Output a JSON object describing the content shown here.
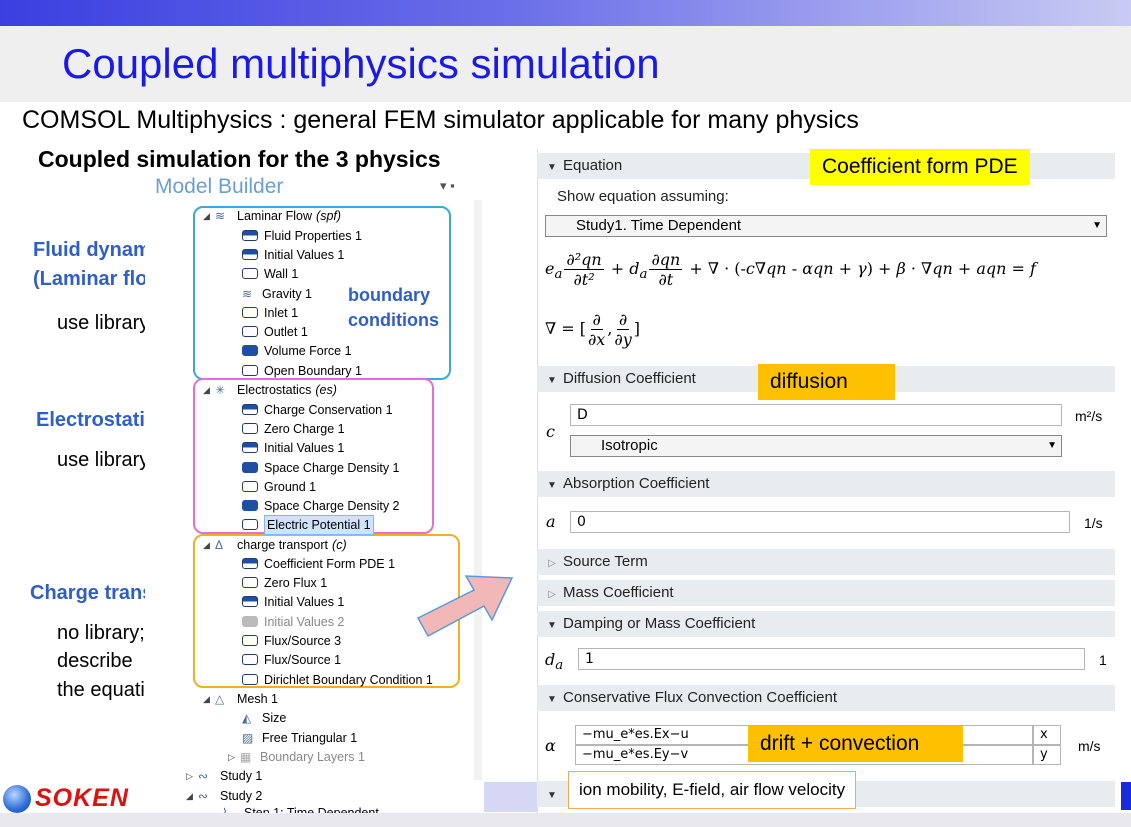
{
  "slide": {
    "title": "Coupled multiphysics simulation",
    "subtitle": "COMSOL Multiphysics : general FEM simulator applicable for many physics",
    "heading": "Coupled simulation for the 3 physics"
  },
  "left_labels": {
    "fluid_line1": "Fluid dynamics",
    "fluid_line2": "(Laminar flow)",
    "fluid_note": "use library",
    "electro": "Electrostatics",
    "electro_note": "use library",
    "charge": "Charge transport",
    "charge_note1": "no library;",
    "charge_note2": "describe",
    "charge_note3": "the equation"
  },
  "model_builder": {
    "header": "Model Builder",
    "boundary_label_line1": "boundary",
    "boundary_label_line2": "conditions",
    "laminar": {
      "name": "Laminar Flow",
      "tag": "(spf)",
      "items": [
        "Fluid Properties 1",
        "Initial Values 1",
        "Wall 1",
        "Gravity 1",
        "Inlet 1",
        "Outlet 1",
        "Volume Force 1",
        "Open Boundary 1"
      ]
    },
    "electrostatics": {
      "name": "Electrostatics",
      "tag": "(es)",
      "items": [
        "Charge Conservation 1",
        "Zero Charge 1",
        "Initial Values 1",
        "Space Charge Density 1",
        "Ground 1",
        "Space Charge Density 2",
        "Electric Potential 1"
      ]
    },
    "charge_transport": {
      "name": "charge transport",
      "tag": "(c)",
      "items": [
        "Coefficient Form PDE 1",
        "Zero Flux 1",
        "Initial Values 1",
        "Initial Values 2",
        "Flux/Source 3",
        "Flux/Source 1",
        "Dirichlet Boundary Condition 1"
      ]
    },
    "mesh": {
      "name": "Mesh 1",
      "items": [
        "Size",
        "Free Triangular 1",
        "Boundary Layers 1"
      ]
    },
    "study1": "Study 1",
    "study2": "Study 2",
    "step": "Step 1: Time Dependent"
  },
  "logo": {
    "text": "SOKEN"
  },
  "panel": {
    "equation_header": "Equation",
    "coef_callout": "Coefficient form PDE",
    "show_eq_label": "Show equation assuming:",
    "study_select": "Study1. Time Dependent",
    "diffusion_header": "Diffusion Coefficient",
    "diffusion_callout": "diffusion",
    "c_symbol": "c",
    "c_value": "D",
    "c_unit": "m²/s",
    "isotropic": "Isotropic",
    "absorption_header": "Absorption Coefficient",
    "a_symbol": "a",
    "a_value": "0",
    "a_unit": "1/s",
    "source_header": "Source Term",
    "mass_header": "Mass Coefficient",
    "damping_header": "Damping or Mass Coefficient",
    "da_symbol": "d",
    "da_sub": "a",
    "da_value": "1",
    "da_unit": "1",
    "convection_header": "Conservative Flux Convection Coefficient",
    "alpha_symbol": "α",
    "alpha_x": "−mu_e*es.Ex−u",
    "alpha_y": "−mu_e*es.Ey−v",
    "x_label": "x",
    "y_label": "y",
    "alpha_unit": "m/s",
    "drift_callout": "drift + convection",
    "ion_callout": "ion mobility, E-field,  air flow velocity"
  },
  "colors": {
    "laminar_box": "#3aa8d8",
    "electro_box": "#e070d8",
    "charge_box": "#f0b020",
    "arrow_fill": "#f2b8b8",
    "arrow_stroke": "#5b9bd5"
  }
}
